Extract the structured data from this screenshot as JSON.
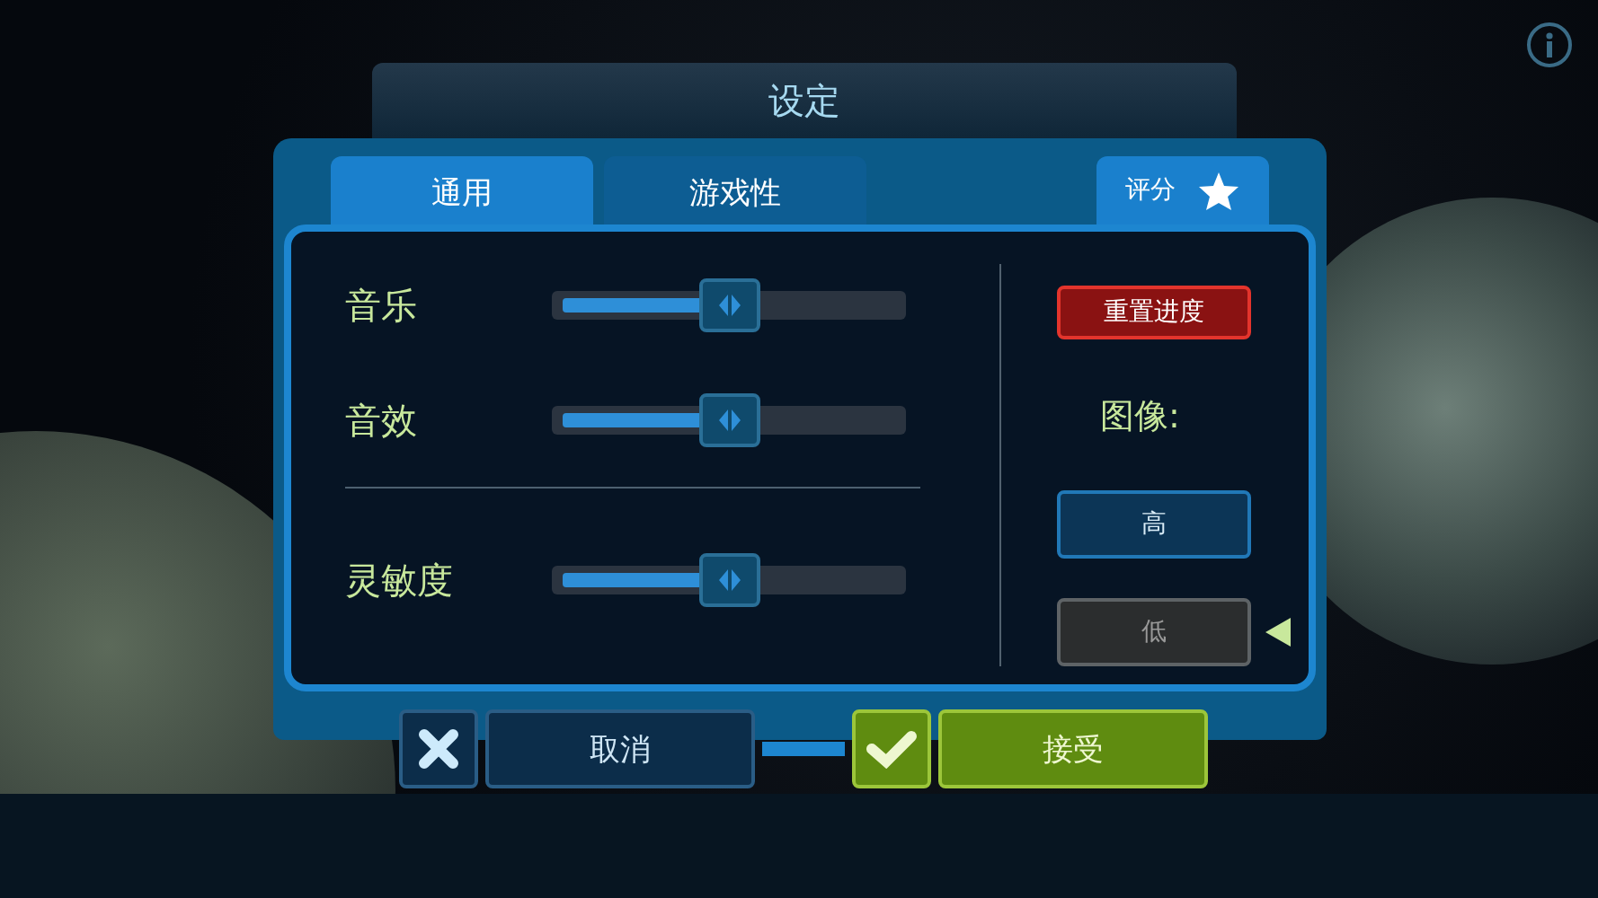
{
  "window": {
    "title": "设定"
  },
  "tabs": [
    {
      "label": "通用",
      "selected": true
    },
    {
      "label": "游戏性",
      "selected": false
    }
  ],
  "rating_button": {
    "label": "评分"
  },
  "slider_groups": [
    {
      "sliders": [
        {
          "label": "音乐",
          "level": 0.5
        },
        {
          "label": "音效",
          "level": 0.5
        }
      ]
    },
    {
      "sliders": [
        {
          "label": "灵敏度",
          "level": 0.5
        }
      ]
    }
  ],
  "reset_button": {
    "label": "重置进度"
  },
  "graphics": {
    "label": "图像:",
    "options": [
      {
        "label": "高",
        "selected": false
      },
      {
        "label": "低",
        "selected": true
      }
    ]
  },
  "buttons": [
    {
      "kind": "cancel",
      "label": "取消"
    },
    {
      "kind": "accept",
      "label": "接受"
    }
  ]
}
